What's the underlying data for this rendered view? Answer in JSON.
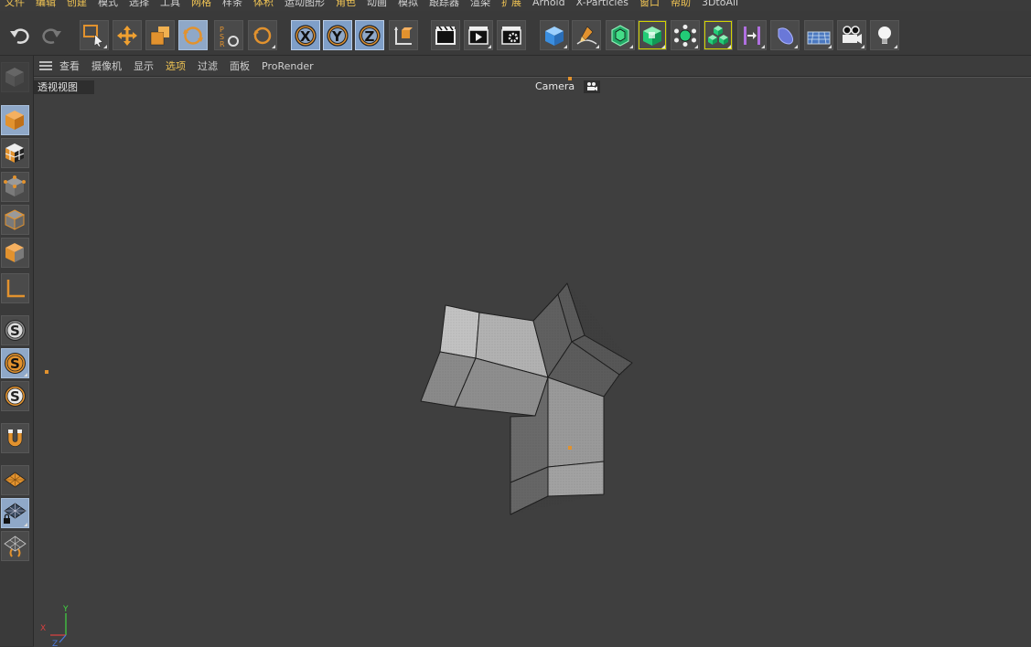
{
  "menu": [
    "文件",
    "编辑",
    "创建",
    "模式",
    "选择",
    "工具",
    "网格",
    "样条",
    "体积",
    "运动图形",
    "角色",
    "动画",
    "模拟",
    "跟踪器",
    "渲染",
    "扩展",
    "Arnold",
    "X-Particles",
    "窗口",
    "帮助",
    "3DtoAll"
  ],
  "viewport_menu": {
    "items": [
      "查看",
      "摄像机",
      "显示",
      "选项",
      "过滤",
      "面板",
      "ProRender"
    ],
    "highlighted": "选项"
  },
  "viewport": {
    "label": "透视视图",
    "camera_label": "Camera",
    "axis": {
      "x": "X",
      "y": "Y",
      "z": "Z"
    }
  },
  "colors": {
    "accent": "#e2922e",
    "active_button": "#8fa8c8",
    "viewport_bg": "#3f3f3f",
    "menu_highlight": "#f0c454"
  },
  "toolbar_icons": [
    "undo-icon",
    "redo-icon",
    "live-selection-icon",
    "move-icon",
    "scale-icon",
    "rotate-icon",
    "psr-icon",
    "recent-tool-icon",
    "x-axis-icon",
    "y-axis-icon",
    "z-axis-icon",
    "coordinate-system-icon",
    "render-view-icon",
    "render-to-picture-viewer-icon",
    "render-settings-icon",
    "cube-primitive-icon",
    "pen-spline-icon",
    "subdivision-surface-icon",
    "extrude-generator-icon",
    "cloner-icon",
    "mograph-cloner-icon",
    "deformer-bend-icon",
    "deformer-twist-icon",
    "floor-icon",
    "camera-icon",
    "light-icon"
  ],
  "left_icons": [
    "make-editable-icon",
    "model-mode-icon",
    "texture-mode-icon",
    "point-mode-icon",
    "edge-mode-icon",
    "polygon-mode-icon",
    "axis-mode-icon",
    "snap-off-icon",
    "snap-on-icon",
    "snap-settings-icon",
    "magnet-icon",
    "workplane-icon",
    "locked-workplane-icon",
    "solo-icon"
  ]
}
